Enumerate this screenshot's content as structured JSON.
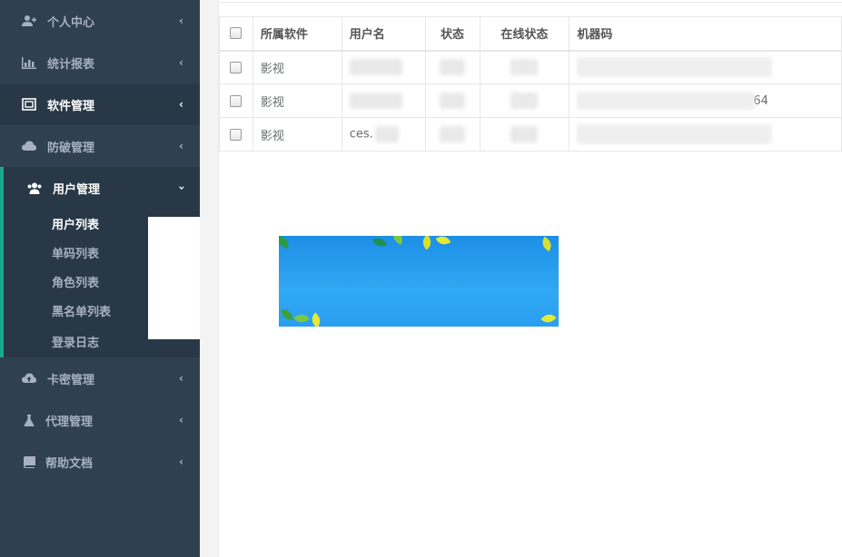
{
  "sidebar": {
    "items": [
      {
        "label": "个人中心",
        "icon": "user-plus-icon"
      },
      {
        "label": "统计报表",
        "icon": "bar-chart-icon"
      },
      {
        "label": "软件管理",
        "icon": "software-icon"
      },
      {
        "label": "防破管理",
        "icon": "cloud-icon"
      },
      {
        "label": "用户管理",
        "icon": "users-icon"
      },
      {
        "label": "卡密管理",
        "icon": "cloud-upload-icon"
      },
      {
        "label": "代理管理",
        "icon": "flask-icon"
      },
      {
        "label": "帮助文档",
        "icon": "book-icon"
      }
    ],
    "user_submenu": [
      {
        "label": "用户列表"
      },
      {
        "label": "单码列表"
      },
      {
        "label": "角色列表"
      },
      {
        "label": "黑名单列表"
      },
      {
        "label": "登录日志"
      }
    ]
  },
  "table": {
    "headers": [
      "所属软件",
      "用户名",
      "状态",
      "在线状态",
      "机器码"
    ],
    "rows": [
      {
        "software": "影视",
        "username": "",
        "status": "",
        "online": "",
        "machine": ""
      },
      {
        "software": "影视",
        "username": "",
        "status": "",
        "online": "",
        "machine": "64"
      },
      {
        "software": "影视",
        "username": "ces.",
        "status": "",
        "online": "",
        "machine": ""
      }
    ]
  },
  "colors": {
    "sidebar_bg": "#2f4050",
    "sidebar_active": "#293846",
    "accent": "#19aa8d",
    "banner": "#2a9ef0"
  }
}
